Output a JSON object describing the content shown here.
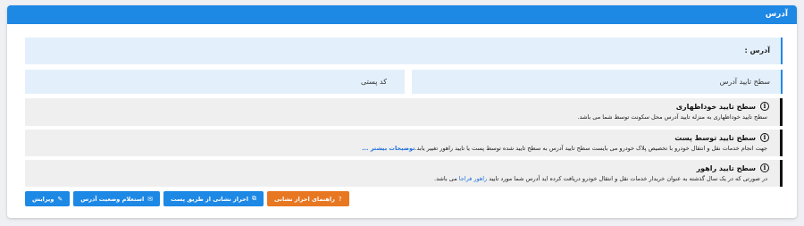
{
  "header": {
    "title": "آدرس"
  },
  "address": {
    "label": "آدرس :"
  },
  "level": {
    "right_label": "سطح تایید آدرس",
    "left_label": "کد پستی"
  },
  "levels": [
    {
      "title": "سطح تایید خوداظهاری",
      "text": "سطح تایید خوداظهاری به منزله تایید آدرس محل سکونت توسط شما می باشد."
    },
    {
      "title": "سطح تایید توسط پست",
      "text": "جهت انجام خدمات نقل و انتقال خودرو با تخصیص پلاک خودرو می بایست سطح تایید آدرس به سطح تایید شده توسط پست یا تایید راهور تغییر یابد.",
      "link": "توضیحات بیشتر ..."
    },
    {
      "title": "سطح تایید راهور",
      "text_before": "در صورتی که در یک سال گذشته به عنوان خریدار خدمات نقل و انتقال خودرو دریافت کرده اید آدرس شما مورد تایید",
      "link": "راهور فراجا",
      "text_after": "می باشد."
    }
  ],
  "buttons": {
    "edit": "ویرایش",
    "inquiry": "استعلام وضعیت آدرس",
    "post_verify": "احراز نشانی از طریق پست",
    "guide": "راهنمای احراز نشانی"
  },
  "icons": {
    "edit": "pencil-icon",
    "inquiry": "envelope-icon",
    "post_verify": "external-link-icon",
    "guide": "question-circle-icon",
    "info": "info-circle-icon"
  },
  "colors": {
    "primary": "#1e88e5",
    "orange": "#e87722",
    "light_blue": "#e3f0fc"
  }
}
